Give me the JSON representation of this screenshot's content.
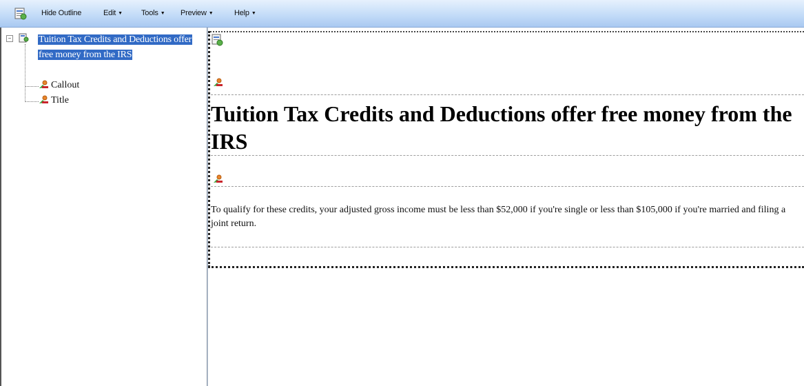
{
  "toolbar": {
    "menu": [
      {
        "label": "Hide Outline",
        "has_dropdown": false
      },
      {
        "label": "Edit",
        "has_dropdown": true
      },
      {
        "label": "Tools",
        "has_dropdown": true
      },
      {
        "label": "Preview",
        "has_dropdown": true
      },
      {
        "label": "Help",
        "has_dropdown": true
      }
    ]
  },
  "outline": {
    "root": {
      "label": "Tuition Tax Credits and Deductions offer free money from the IRS",
      "selected": true,
      "expanded": true
    },
    "children": [
      {
        "label": "Callout"
      },
      {
        "label": "Title"
      }
    ]
  },
  "document": {
    "title": "Tuition Tax Credits and Deductions offer free money from the IRS",
    "callout": "To qualify for these credits, your adjusted gross income must be less than $52,000 if you're single or less than $105,000 if you're married and filing a joint return."
  },
  "colors": {
    "selection": "#316ac5",
    "toolbar_top": "#e6f1fd",
    "toolbar_bottom": "#a9c9f1"
  },
  "icons": {
    "toolbar": "page-icon",
    "outline_root": "page-icon",
    "outline_child": "component-icon"
  }
}
